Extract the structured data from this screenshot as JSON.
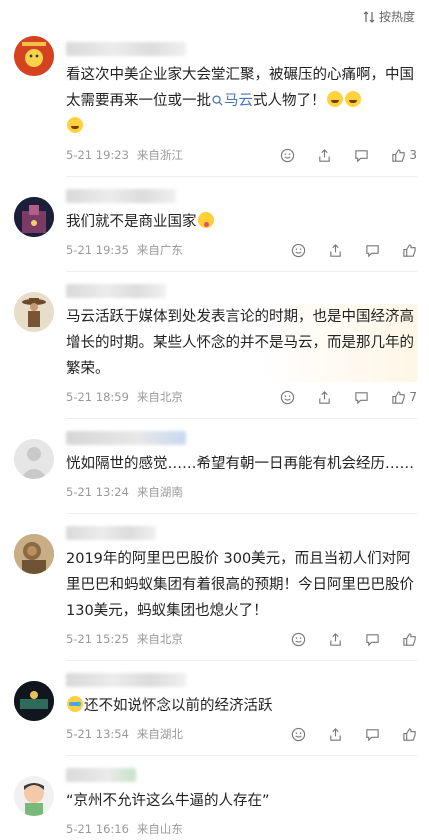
{
  "header": {
    "sort_label": "按热度"
  },
  "comments": [
    {
      "text_parts": [
        "看这次中美企业家大会堂汇聚，被碾压的心痛啊，中国太需要再来一位或一批",
        "马云",
        "式人物了！"
      ],
      "time": "5-21 19:23",
      "location": "来自浙江",
      "likes": "3"
    },
    {
      "text": "我们就不是商业国家",
      "time": "5-21 19:35",
      "location": "来自广东",
      "likes": ""
    },
    {
      "text": "马云活跃于媒体到处发表言论的时期，也是中国经济高增长的时期。某些人怀念的并不是马云，而是那几年的繁荣。",
      "time": "5-21 18:59",
      "location": "来自北京",
      "likes": "7"
    },
    {
      "text": "恍如隔世的感觉……希望有朝一日再能有机会经历……",
      "time": "5-21 13:24",
      "location": "来自湖南",
      "likes": ""
    },
    {
      "text": "2019年的阿里巴巴股价 300美元，而且当初人们对阿里巴巴和蚂蚁集团有着很高的预期！今日阿里巴巴股价 130美元，蚂蚁集团也熄火了！",
      "time": "5-21 15:25",
      "location": "来自北京",
      "likes": ""
    },
    {
      "text": "还不如说怀念以前的经济活跃",
      "time": "5-21 13:54",
      "location": "来自湖北",
      "likes": ""
    },
    {
      "text": "“京州不允许这么牛逼的人存在”",
      "time": "5-21 16:16",
      "location": "来自山东",
      "likes": ""
    }
  ]
}
